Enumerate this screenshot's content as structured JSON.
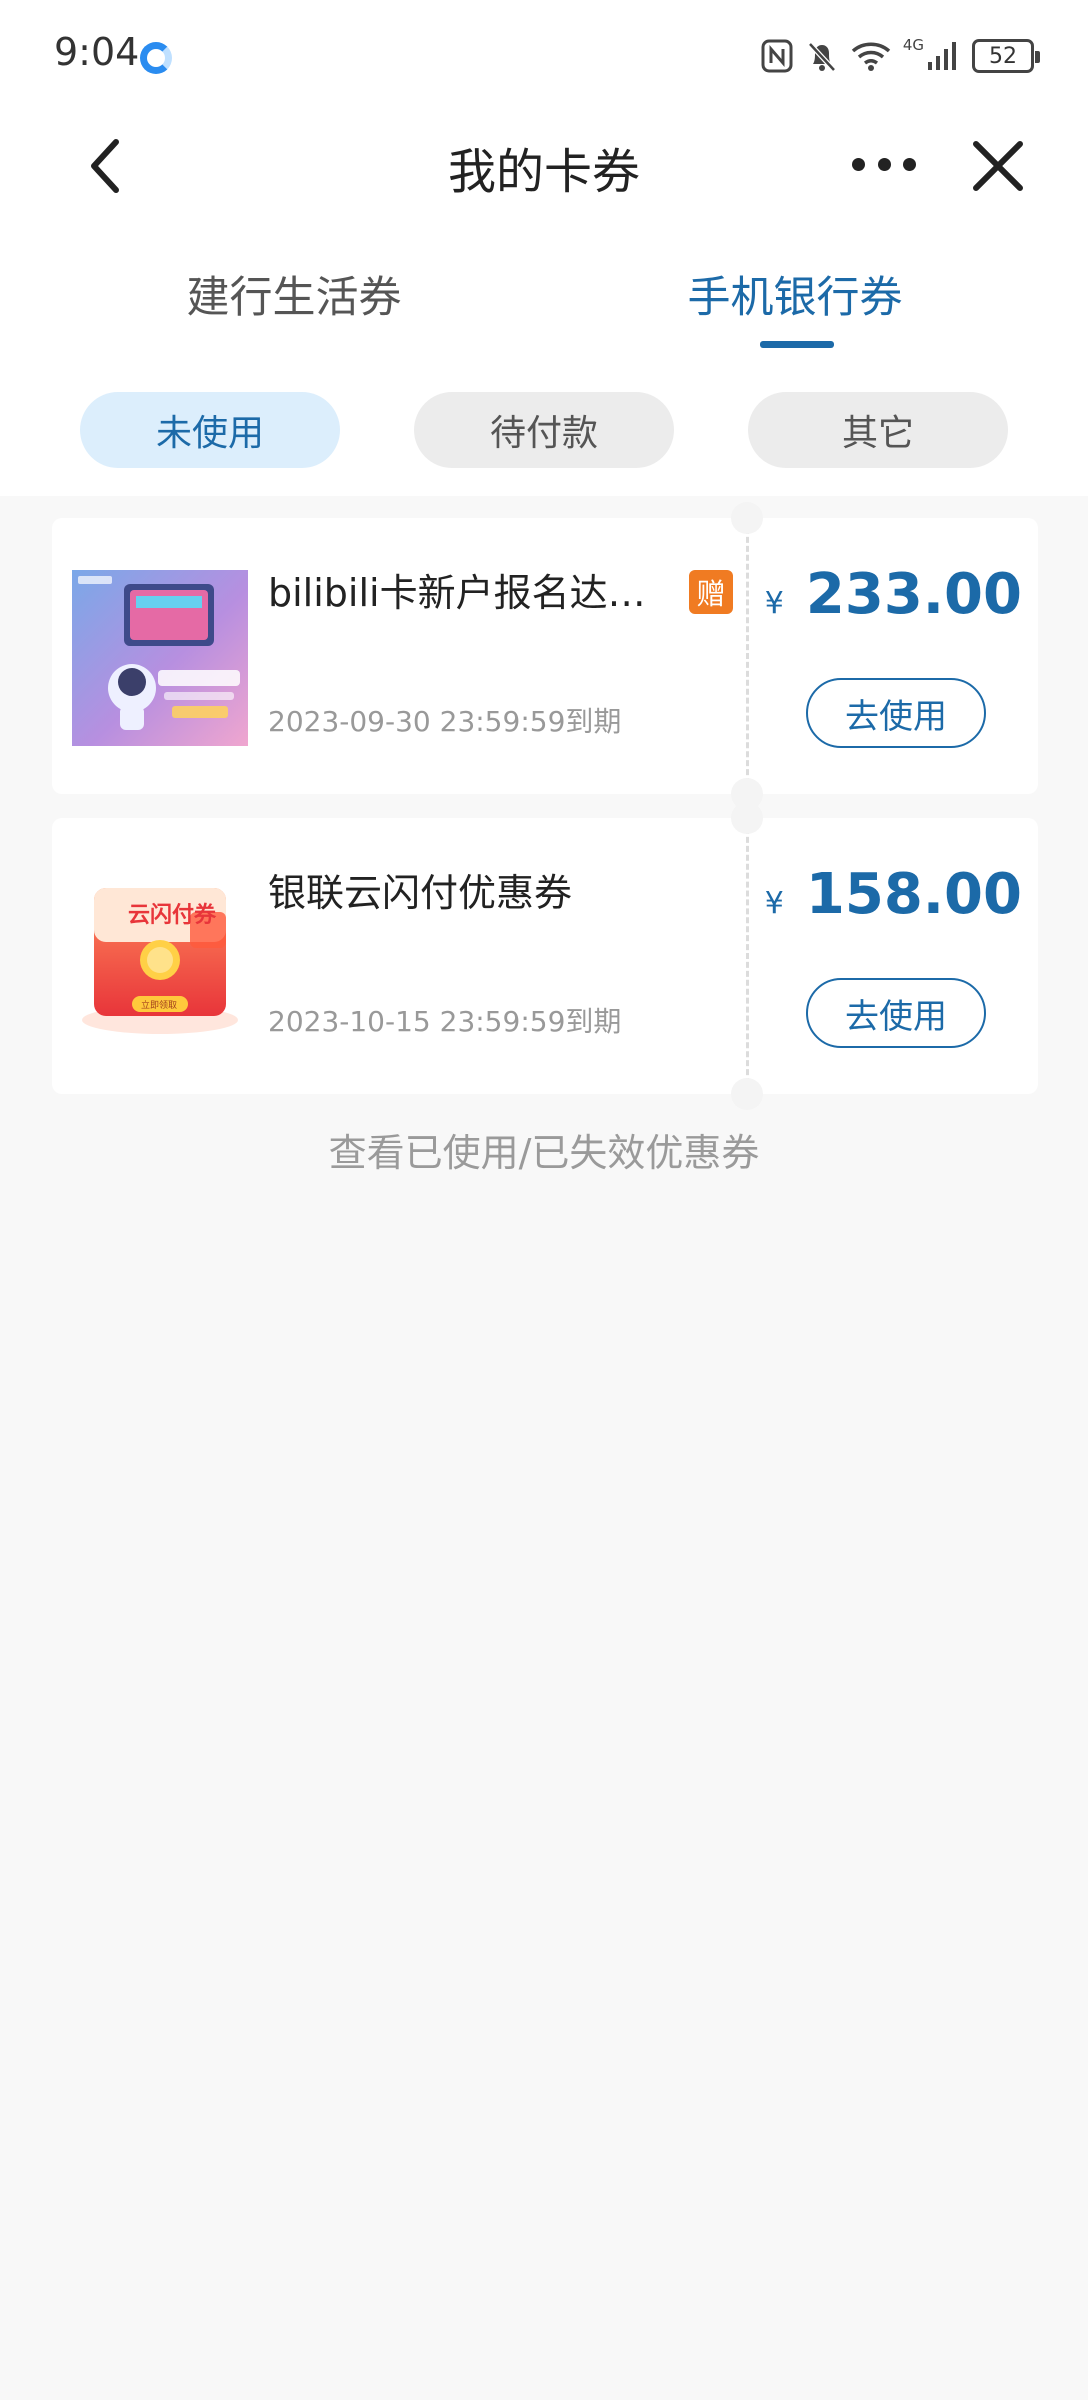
{
  "status_bar": {
    "time": "9:04",
    "network": "4G",
    "battery": "52",
    "icons": [
      "cloud-icon",
      "nfc-icon",
      "bell-mute-icon",
      "wifi-icon",
      "signal-icon",
      "battery-icon"
    ]
  },
  "nav": {
    "title": "我的卡券"
  },
  "tabs": [
    {
      "label": "建行生活券",
      "active": false
    },
    {
      "label": "手机银行券",
      "active": true
    }
  ],
  "filters": [
    {
      "label": "未使用",
      "active": true
    },
    {
      "label": "待付款",
      "active": false
    },
    {
      "label": "其它",
      "active": false
    }
  ],
  "coupons": [
    {
      "name": "bilibili卡新户报名达标礼",
      "badge": "赠",
      "expiry": "2023-09-30 23:59:59到期",
      "currency": "¥",
      "amount": "233.00",
      "action": "去使用"
    },
    {
      "name": "银联云闪付优惠券",
      "image_text": "云闪付券",
      "image_button": "立即领取",
      "expiry": "2023-10-15 23:59:59到期",
      "currency": "¥",
      "amount": "158.00",
      "action": "去使用"
    }
  ],
  "history_link": "查看已使用/已失效优惠券",
  "colors": {
    "accent": "#1c6aa8",
    "chip_active_bg": "#dceefc",
    "gift_badge": "#f07b22",
    "page_bg": "#f8f8f8"
  }
}
